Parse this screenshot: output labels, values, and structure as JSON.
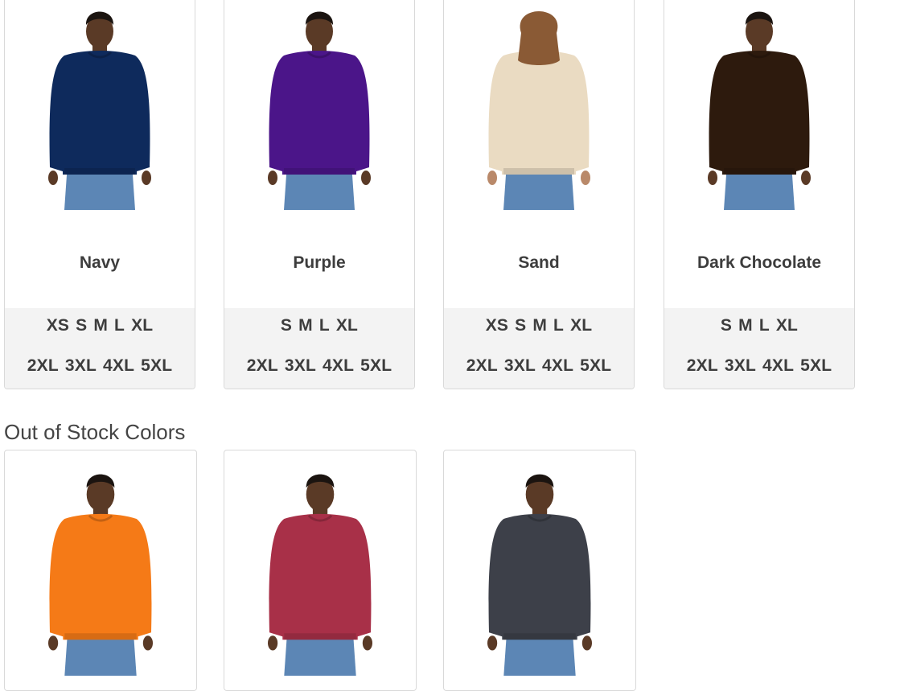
{
  "in_stock": [
    {
      "color_name": "Navy",
      "shirt_color": "#0e2a5c",
      "model": "male",
      "sizes_row1": [
        "XS",
        "S",
        "M",
        "L",
        "XL"
      ],
      "sizes_row2": [
        "2XL",
        "3XL",
        "4XL",
        "5XL"
      ]
    },
    {
      "color_name": "Purple",
      "shirt_color": "#4b1589",
      "model": "male",
      "sizes_row1": [
        "S",
        "M",
        "L",
        "XL"
      ],
      "sizes_row2": [
        "2XL",
        "3XL",
        "4XL",
        "5XL"
      ]
    },
    {
      "color_name": "Sand",
      "shirt_color": "#eadbc2",
      "model": "female",
      "sizes_row1": [
        "XS",
        "S",
        "M",
        "L",
        "XL"
      ],
      "sizes_row2": [
        "2XL",
        "3XL",
        "4XL",
        "5XL"
      ]
    },
    {
      "color_name": "Dark Chocolate",
      "shirt_color": "#2d1a0d",
      "model": "male",
      "sizes_row1": [
        "S",
        "M",
        "L",
        "XL"
      ],
      "sizes_row2": [
        "2XL",
        "3XL",
        "4XL",
        "5XL"
      ]
    }
  ],
  "out_of_stock_heading": "Out of Stock Colors",
  "out_of_stock": [
    {
      "shirt_color": "#f57a17",
      "model": "male"
    },
    {
      "shirt_color": "#a83048",
      "model": "male"
    },
    {
      "shirt_color": "#3d4049",
      "model": "male"
    }
  ],
  "colors": {
    "skin": "#5a3a26",
    "skin_female": "#b9896a",
    "hair": "#1b1410",
    "hair_female": "#8a5a35",
    "jeans": "#5c86b5",
    "card_border": "#d9d9d9",
    "sizes_bg": "#f3f3f3"
  }
}
